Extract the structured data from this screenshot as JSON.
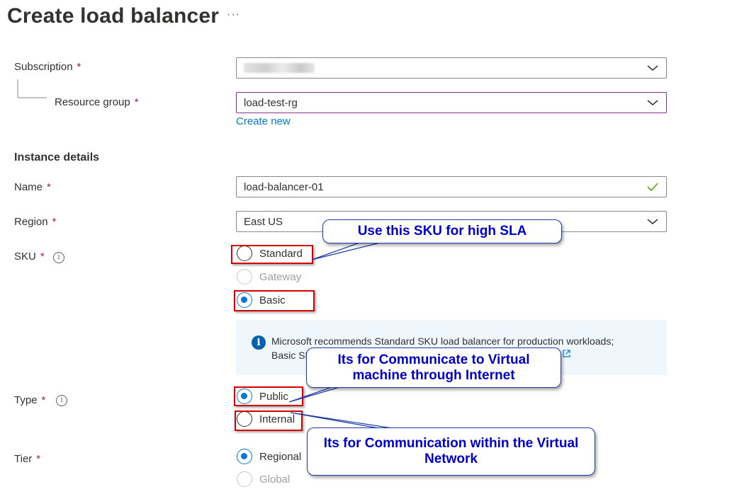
{
  "header": {
    "title": "Create load balancer",
    "more": "···"
  },
  "required_mark": "*",
  "subscription": {
    "label": "Subscription"
  },
  "resource_group": {
    "label": "Resource group",
    "value": "load-test-rg",
    "create_new": "Create new"
  },
  "instance_details": {
    "heading": "Instance details"
  },
  "name": {
    "label": "Name",
    "value": "load-balancer-01"
  },
  "region": {
    "label": "Region",
    "value": "East US"
  },
  "sku": {
    "label": "SKU",
    "options": [
      {
        "label": "Standard",
        "state": "unselected"
      },
      {
        "label": "Gateway",
        "state": "disabled"
      },
      {
        "label": "Basic",
        "state": "selected"
      }
    ]
  },
  "info": {
    "line1": "Microsoft recommends Standard SKU load balancer for production workloads;",
    "line2_start": "Basic SK"
  },
  "type": {
    "label": "Type",
    "options": [
      {
        "label": "Public",
        "state": "selected"
      },
      {
        "label": "Internal",
        "state": "unselected"
      }
    ]
  },
  "tier": {
    "label": "Tier",
    "options": [
      {
        "label": "Regional",
        "state": "selected"
      },
      {
        "label": "Global",
        "state": "disabled"
      }
    ]
  },
  "callouts": {
    "sku": "Use this SKU for high SLA",
    "public": "Its for Communicate to Virtual machine through Internet",
    "internal": "Its for Communication within the Virtual Network"
  },
  "colors": {
    "accent": "#0078d4",
    "required": "#a4262c",
    "highlight_border": "#d60000",
    "callout_text": "#0000cc",
    "info_background": "#eff6fc",
    "valid_check": "#57a300"
  }
}
